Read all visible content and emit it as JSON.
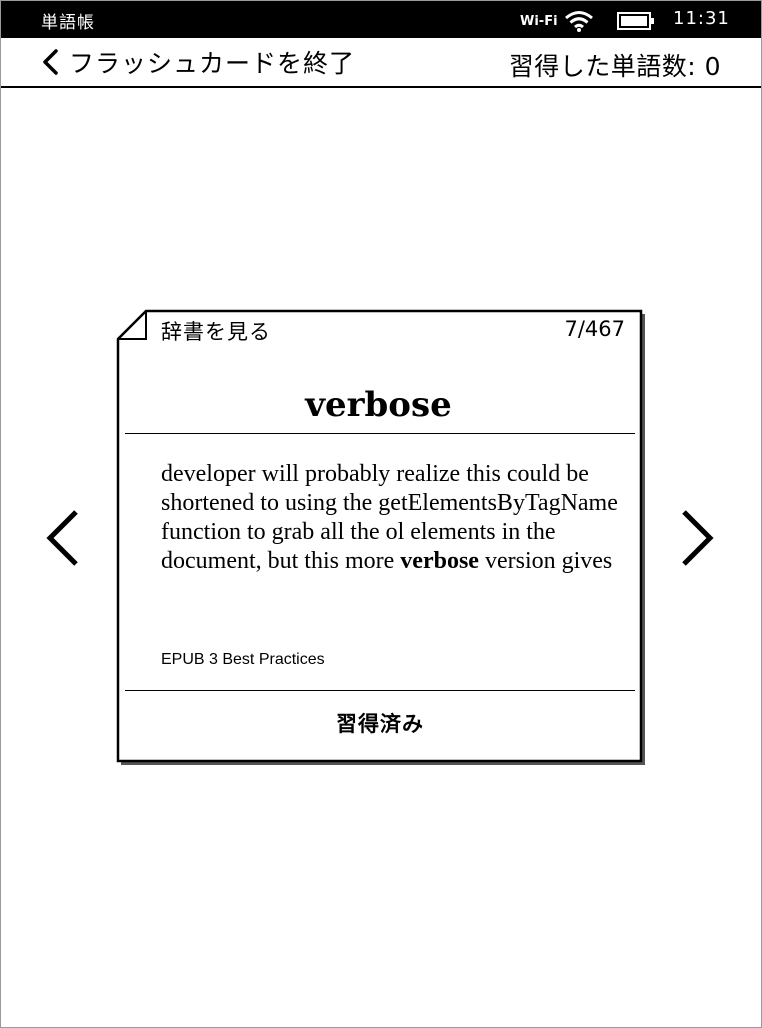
{
  "status_bar": {
    "title": "単語帳",
    "wifi_label": "Wi-Fi",
    "wifi_icon": "wifi-icon",
    "battery_icon": "battery-icon",
    "time": "11:31"
  },
  "header": {
    "back_icon": "chevron-left-icon",
    "exit_label": "フラッシュカードを終了",
    "learned_count_label": "習得した単語数: 0"
  },
  "navigation": {
    "prev_icon": "chevron-left-icon",
    "next_icon": "chevron-right-icon"
  },
  "card": {
    "dictionary_link": "辞書を見る",
    "counter": "7/467",
    "headword": "verbose",
    "usage_before": "developer will probably realize this could be shortened to using the getElementsByTagName function to grab all the ol elements in the document, but this more ",
    "usage_highlight": "verbose",
    "usage_after": " version gives",
    "book_title": "EPUB 3 Best Practices",
    "mark_learned_label": "習得済み"
  },
  "colors": {
    "status_bar_bg": "#000000",
    "text": "#000000",
    "background": "#ffffff"
  }
}
